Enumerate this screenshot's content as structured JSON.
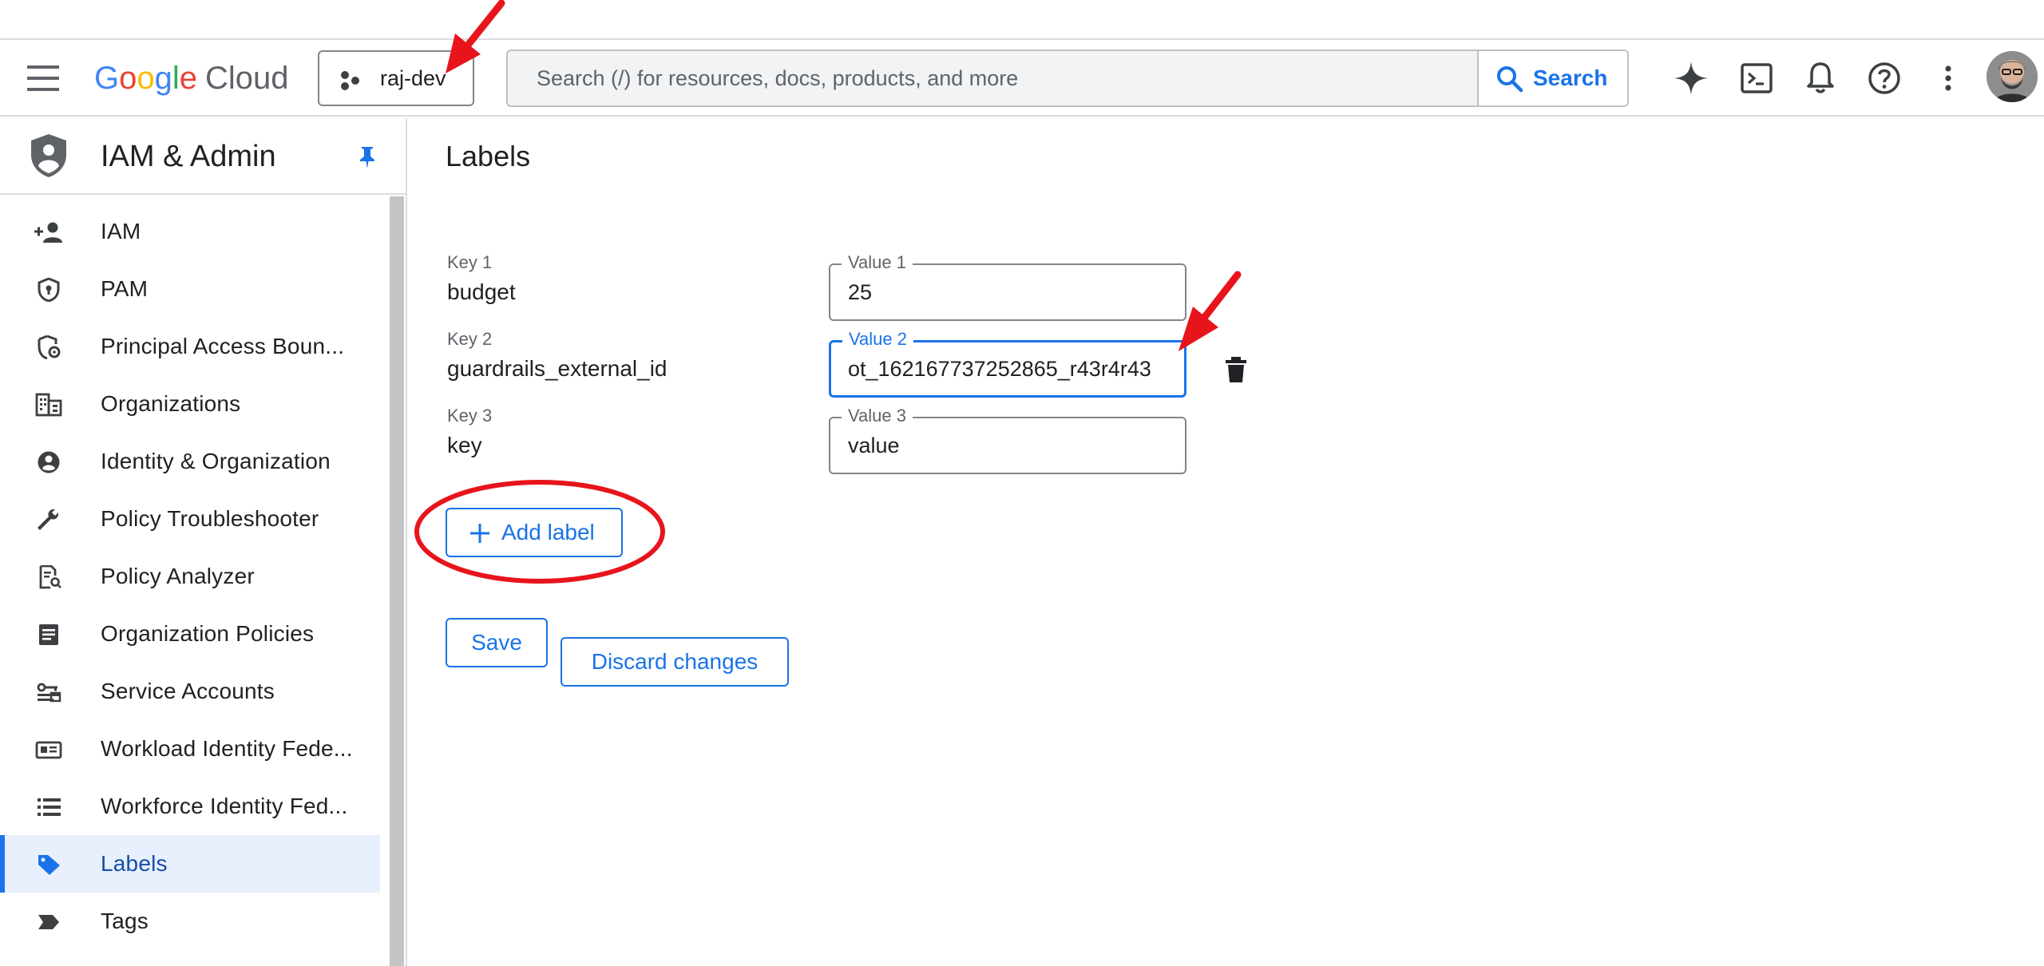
{
  "header": {
    "logo": {
      "google": "Google",
      "cloud": "Cloud"
    },
    "project": "raj-dev",
    "search": {
      "placeholder": "Search (/) for resources, docs, products, and more",
      "button_label": "Search"
    },
    "icons": [
      "gemini-sparkle-icon",
      "cloud-shell-icon",
      "notifications-bell-icon",
      "help-icon",
      "more-vert-icon",
      "account-avatar"
    ]
  },
  "sidebar": {
    "title": "IAM & Admin",
    "items": [
      {
        "label": "IAM",
        "icon": "person-add-icon"
      },
      {
        "label": "PAM",
        "icon": "shield-lock-icon"
      },
      {
        "label": "Principal Access Boun...",
        "icon": "shield-settings-icon"
      },
      {
        "label": "Organizations",
        "icon": "business-icon"
      },
      {
        "label": "Identity & Organization",
        "icon": "account-circle-icon"
      },
      {
        "label": "Policy Troubleshooter",
        "icon": "wrench-icon"
      },
      {
        "label": "Policy Analyzer",
        "icon": "document-search-icon"
      },
      {
        "label": "Organization Policies",
        "icon": "article-icon"
      },
      {
        "label": "Service Accounts",
        "icon": "service-account-icon"
      },
      {
        "label": "Workload Identity Fede...",
        "icon": "id-card-icon"
      },
      {
        "label": "Workforce Identity Fed...",
        "icon": "list-icon"
      },
      {
        "label": "Labels",
        "icon": "label-tag-icon",
        "active": true
      },
      {
        "label": "Tags",
        "icon": "tag-arrow-icon"
      }
    ]
  },
  "main": {
    "title": "Labels",
    "labels": [
      {
        "key_label": "Key 1",
        "key": "budget",
        "value_label": "Value 1",
        "value": "25"
      },
      {
        "key_label": "Key 2",
        "key": "guardrails_external_id",
        "value_label": "Value 2",
        "value": "ot_162167737252865_r43r4r43",
        "focused": true
      },
      {
        "key_label": "Key 3",
        "key": "key",
        "value_label": "Value 3",
        "value": "value"
      }
    ],
    "add_label": "Add label",
    "save": "Save",
    "discard": "Discard changes"
  },
  "annotations": {
    "color": "#e8141b",
    "items": [
      "arrow-to-project-picker",
      "arrow-to-value-2-field",
      "circle-around-add-label"
    ]
  },
  "colors": {
    "accent": "#1a73e8",
    "active_bg": "#e8f0fe",
    "annotation": "#e8141b"
  }
}
